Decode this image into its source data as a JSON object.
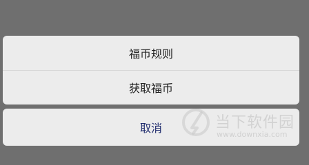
{
  "action_sheet": {
    "items": [
      {
        "label": "福币规则"
      },
      {
        "label": "获取福币"
      }
    ],
    "cancel_label": "取消"
  },
  "watermark": {
    "title": "当下软件园",
    "url": "www.downxia.com"
  },
  "colors": {
    "overlay": "#6f6f6f",
    "sheet_bg": "#ececec",
    "cancel_text": "#1f2b6d"
  }
}
